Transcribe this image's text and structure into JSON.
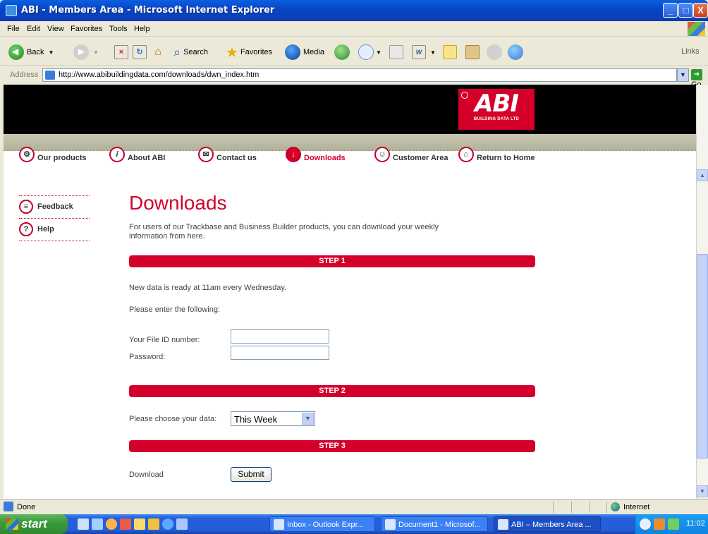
{
  "window": {
    "title": "ABI - Members Area - Microsoft Internet Explorer",
    "minimize": "_",
    "maximize": "□",
    "close": "X"
  },
  "menubar": [
    "File",
    "Edit",
    "View",
    "Favorites",
    "Tools",
    "Help"
  ],
  "toolbar": {
    "back": "Back",
    "search": "Search",
    "favorites": "Favorites",
    "media": "Media",
    "links": "Links"
  },
  "address": {
    "label": "Address",
    "url": "http://www.abibuildingdata.com/downloads/dwn_index.htm",
    "go": "Go"
  },
  "brand": {
    "logo_text": "ABI",
    "logo_sub": "BUILDING DATA LTD",
    "accent": "#d4002a"
  },
  "nav": [
    {
      "label": "Our products",
      "icon": "products-icon"
    },
    {
      "label": "About ABI",
      "icon": "info-icon"
    },
    {
      "label": "Contact us",
      "icon": "envelope-icon"
    },
    {
      "label": "Downloads",
      "icon": "download-icon",
      "active": true
    },
    {
      "label": "Customer Area",
      "icon": "person-icon"
    },
    {
      "label": "Return to Home",
      "icon": "home-icon"
    }
  ],
  "sidebar": [
    {
      "label": "Feedback",
      "icon": "feedback-icon"
    },
    {
      "label": "Help",
      "icon": "help-icon"
    }
  ],
  "main": {
    "title": "Downloads",
    "intro": "For users of our Trackbase and Business Builder products, you can download your weekly information from here.",
    "step1": "STEP 1",
    "ready_note": "New data is ready at 11am every Wednesday.",
    "enter_note": "Please enter the following:",
    "file_id_label": "Your File ID number:",
    "file_id_value": "",
    "password_label": "Password:",
    "password_value": "",
    "step2": "STEP 2",
    "choose_label": "Please choose your data:",
    "choose_value": "This Week",
    "step3": "STEP 3",
    "download_label": "Download",
    "submit": "Submit"
  },
  "status": {
    "text": "Done",
    "zone": "Internet"
  },
  "taskbar": {
    "start": "start",
    "tasks": [
      "Inbox - Outlook Expr...",
      "Document1 - Microsof...",
      "ABI – Members Area ..."
    ],
    "clock": "11:02"
  }
}
